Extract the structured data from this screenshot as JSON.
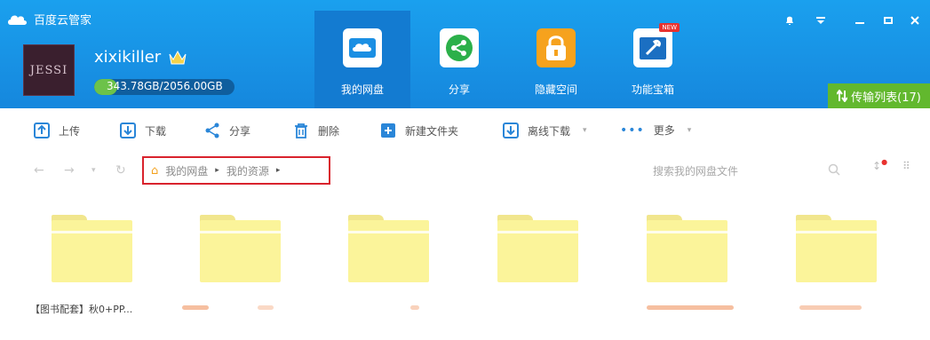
{
  "app": {
    "title": "百度云管家"
  },
  "user": {
    "avatar_text": "JESSI",
    "name": "xixikiller",
    "quota_text": "343.78GB/2056.00GB",
    "quota_fraction": 0.167
  },
  "nav": [
    {
      "label": "我的网盘",
      "icon": "cloud-drive-icon",
      "active": true
    },
    {
      "label": "分享",
      "icon": "share-icon",
      "active": false
    },
    {
      "label": "隐藏空间",
      "icon": "lock-icon",
      "active": false
    },
    {
      "label": "功能宝箱",
      "icon": "toolbox-icon",
      "active": false,
      "badge": "NEW"
    }
  ],
  "window_controls": [
    "bell-icon",
    "menu-icon",
    "minimize-icon",
    "maximize-icon",
    "close-icon"
  ],
  "transfer": {
    "label": "传输列表(17)"
  },
  "toolbar": {
    "upload": "上传",
    "download": "下载",
    "share": "分享",
    "delete": "删除",
    "new_folder": "新建文件夹",
    "offline": "离线下载",
    "more": "更多"
  },
  "breadcrumb": [
    "我的网盘",
    "我的资源"
  ],
  "search": {
    "placeholder": "搜索我的网盘文件"
  },
  "folders": [
    {
      "name": "【图书配套】秋0+PP..."
    },
    {
      "name": ""
    },
    {
      "name": ""
    },
    {
      "name": ""
    },
    {
      "name": ""
    },
    {
      "name": ""
    }
  ],
  "colors": {
    "header": "#1a96e8",
    "active_tab": "#137bd1",
    "transfer": "#62b82e",
    "folder": "#fbf49a",
    "highlight": "#d9232d"
  }
}
